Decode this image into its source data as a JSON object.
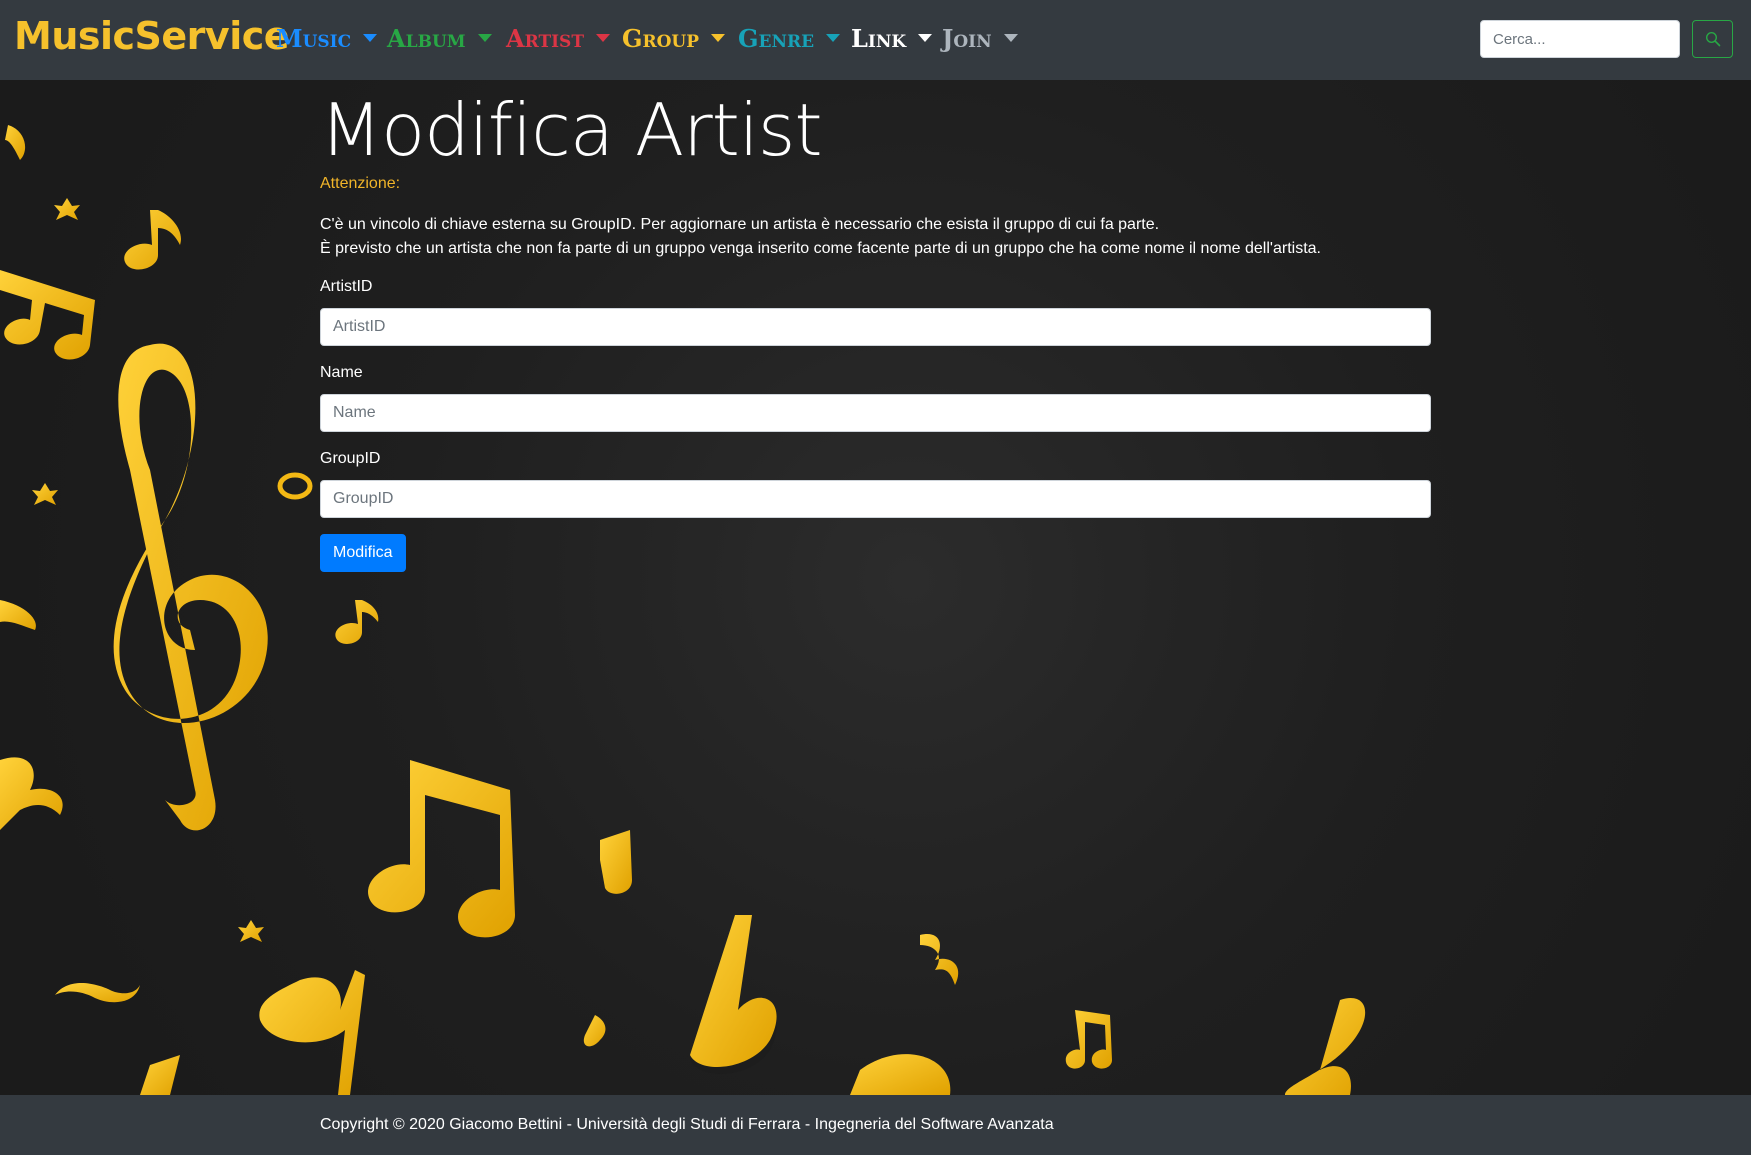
{
  "nav": {
    "brand": "MusicService",
    "items": [
      {
        "label": "Music",
        "color": "#1a8cff"
      },
      {
        "label": "Album",
        "color": "#28a745"
      },
      {
        "label": "Artist",
        "color": "#dc3545"
      },
      {
        "label": "Group",
        "color": "#f6c12c"
      },
      {
        "label": "Genre",
        "color": "#17a2b8"
      },
      {
        "label": "Link",
        "color": "#ffffff"
      },
      {
        "label": "Join",
        "color": "#adb5bd"
      }
    ],
    "search_placeholder": "Cerca...",
    "search_icon": "search-icon"
  },
  "main": {
    "title": "Modifica Artist",
    "warning": "Attenzione:",
    "info_line1": "C'è un vincolo di chiave esterna su GroupID. Per aggiornare un artista è necessario che esista il gruppo di cui fa parte.",
    "info_line2": "È previsto che un artista che non fa parte di un gruppo venga inserito come facente parte di un gruppo che ha come nome il nome dell'artista.",
    "fields": [
      {
        "label": "ArtistID",
        "placeholder": "ArtistID",
        "value": ""
      },
      {
        "label": "Name",
        "placeholder": "Name",
        "value": ""
      },
      {
        "label": "GroupID",
        "placeholder": "GroupID",
        "value": ""
      }
    ],
    "submit_label": "Modifica"
  },
  "footer": {
    "text": "Copyright © 2020 Giacomo Bettini - Università degli Studi di Ferrara - Ingegneria del Software Avanzata"
  },
  "colors": {
    "accent_gold": "#f6c12c",
    "primary": "#007bff",
    "navbar_bg": "#343a40"
  }
}
